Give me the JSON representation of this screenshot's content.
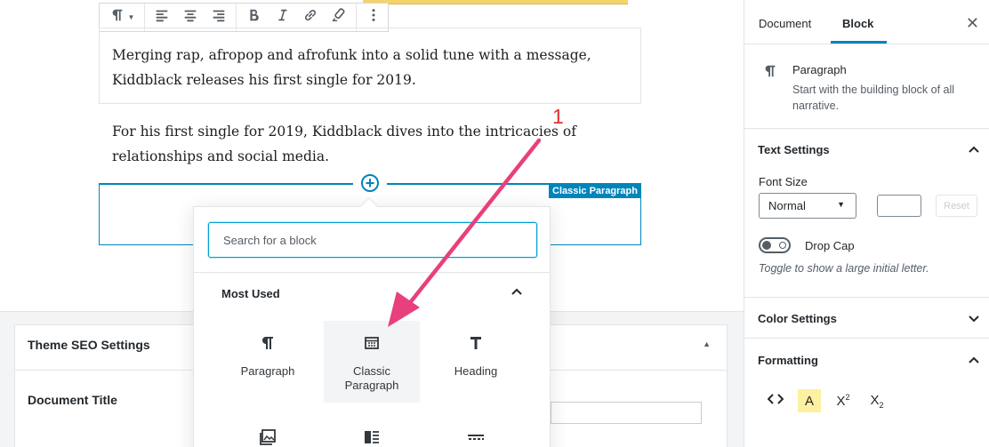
{
  "editor": {
    "toolbar": {
      "paragraph_icon": "pilcrow-icon",
      "align_left_icon": "align-left-icon",
      "align_center_icon": "align-center-icon",
      "align_right_icon": "align-right-icon",
      "bold_icon": "bold-icon",
      "italic_icon": "italic-icon",
      "link_icon": "link-icon",
      "strike_icon": "strikethrough-icon",
      "more_icon": "more-vertical-icon"
    },
    "first_paragraph": "Merging rap, afropop and afrofunk into a solid tune with a message, Kiddblack releases his first single for 2019.",
    "second_paragraph": "For his first single for 2019, Kiddblack dives into the intricacies of relationships and social media.",
    "classic_label": "Classic Paragraph",
    "annotation_number": "1"
  },
  "inserter": {
    "search_placeholder": "Search for a block",
    "section_title": "Most Used",
    "blocks": [
      {
        "label": "Paragraph",
        "icon": "pilcrow-icon"
      },
      {
        "label": "Classic Paragraph",
        "icon": "classic-table-icon"
      },
      {
        "label": "Heading",
        "icon": "heading-t-icon"
      }
    ],
    "row2_icons": [
      "gallery-icon",
      "media-text-icon",
      "separator-icon"
    ]
  },
  "seo": {
    "title": "Theme SEO Settings",
    "document_title_label": "Document Title"
  },
  "sidebar": {
    "tabs": {
      "document": "Document",
      "block": "Block"
    },
    "close_icon": "close-icon",
    "block_card": {
      "title": "Paragraph",
      "description": "Start with the building block of all narrative."
    },
    "text_settings": {
      "title": "Text Settings",
      "font_size_label": "Font Size",
      "font_size_value": "Normal",
      "reset_label": "Reset",
      "drop_cap_label": "Drop Cap",
      "drop_cap_help": "Toggle to show a large initial letter."
    },
    "color_settings": {
      "title": "Color Settings"
    },
    "formatting": {
      "title": "Formatting",
      "icons": [
        "code-icon",
        "highlight-icon",
        "superscript-icon",
        "subscript-icon"
      ]
    }
  },
  "colors": {
    "accent": "#0085ba",
    "annotation": "#e8407c",
    "annotation_number": "#e2312f"
  }
}
